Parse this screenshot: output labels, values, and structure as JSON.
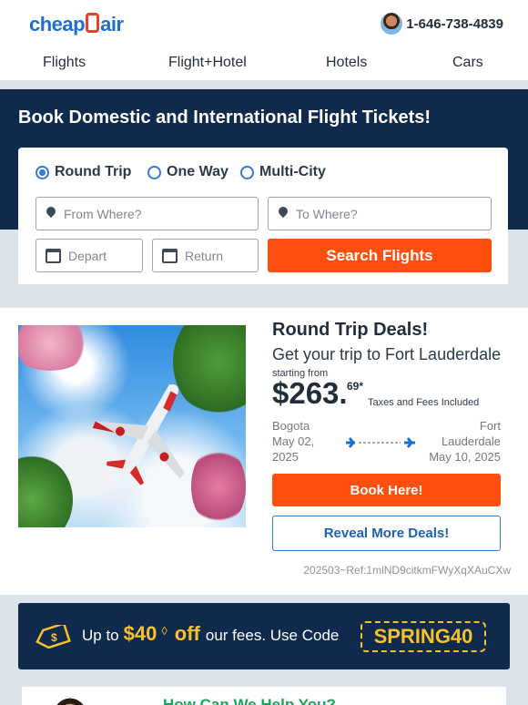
{
  "header": {
    "logo_left": "cheap",
    "logo_right": "air",
    "phone": "1-646-738-4839"
  },
  "nav": [
    "Flights",
    "Flight+Hotel",
    "Hotels",
    "Cars"
  ],
  "hero": {
    "title": "Book Domestic and International Flight Tickets!"
  },
  "search": {
    "trip_types": [
      {
        "label": "Round Trip",
        "selected": true
      },
      {
        "label": "One Way",
        "selected": false
      },
      {
        "label": "Multi-City",
        "selected": false
      }
    ],
    "from_placeholder": "From Where?",
    "to_placeholder": "To Where?",
    "depart_placeholder": "Depart",
    "return_placeholder": "Return",
    "search_button": "Search Flights"
  },
  "deal": {
    "title": "Round Trip Deals!",
    "subtitle": "Get your trip to Fort Lauderdale",
    "starting_from": "starting from",
    "price": "$263.",
    "cents": "69*",
    "taxes": "Taxes and Fees Included",
    "origin": {
      "city": "Bogota",
      "date": "May 02, 2025"
    },
    "destination": {
      "city": "Fort Lauderdale",
      "date": "May 10, 2025"
    },
    "book_button": "Book Here!",
    "reveal_button": "Reveal More Deals!",
    "reference": "202503~Ref:1mlND9citkmFWyXqXAuCXw"
  },
  "promo": {
    "prefix": "Up to",
    "amount": "$40",
    "off": "off",
    "suffix": "our fees. Use Code",
    "code": "SPRING40"
  },
  "help": {
    "title": "How Can We Help You?"
  },
  "colors": {
    "brand_blue": "#1c6fcf",
    "navy": "#0f2a4c",
    "orange": "#fe4f10",
    "promo_gold": "#f6c22b"
  }
}
